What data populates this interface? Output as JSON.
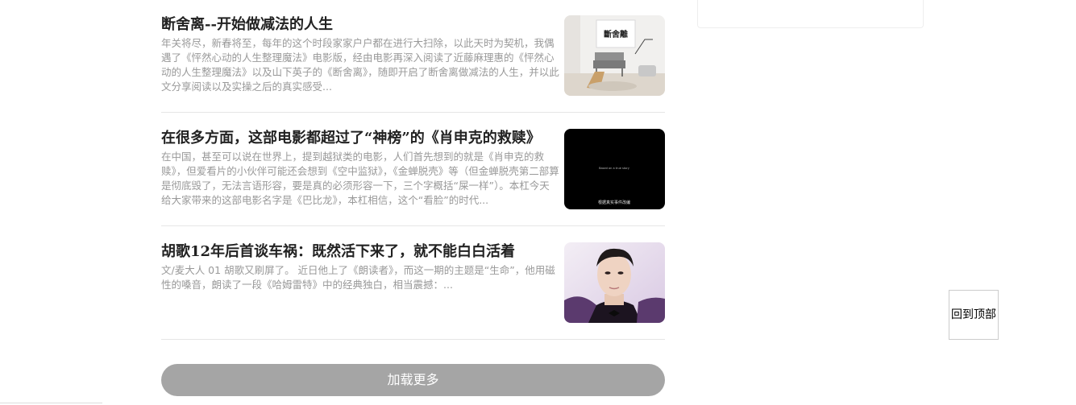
{
  "articles": [
    {
      "title": "断舍离--开始做减法的人生",
      "summary": "年关将尽，新春将至，每年的这个时段家家户户都在进行大扫除，以此天时为契机，我偶遇了《怦然心动的人生整理魔法》电影版，经由电影再深入阅读了近藤麻理惠的《怦然心动的人生整理魔法》以及山下英子的《断舍离》，随即开启了断舍离做减法的人生，并以此文分享阅读以及实操之后的真实感受...",
      "thumb_sign_text": "斷舍離"
    },
    {
      "title": "在很多方面，这部电影都超过了“神榜”的《肖申克的救赎》",
      "summary": "在中国，甚至可以说在世界上，提到越狱类的电影，人们首先想到的就是《肖申克的救赎》，但爱看片的小伙伴可能还会想到《空中监狱》，《金蝉脱壳》等（但金蝉脱壳第二部算是彻底毁了，无法言语形容，要是真的必须形容一下，三个字概括“屎一样”）。本杠今天给大家带来的这部电影名字是《巴比龙》，本杠相信，这个“看脸”的时代...",
      "thumb_caption_top": "Based on a true story",
      "thumb_caption_bottom": "根据真实事件改编"
    },
    {
      "title": "胡歌12年后首谈车祸：既然活下来了，就不能白白活着",
      "summary": "文/麦大人 01 胡歌又刷屏了。 近日他上了《朗读者》，而这一期的主题是“生命”，他用磁性的嗓音，朗读了一段《哈姆雷特》中的经典独白，相当震撼：..."
    }
  ],
  "load_more_label": "加载更多",
  "back_to_top_label": "回到顶部",
  "colors": {
    "title": "#222222",
    "summary": "#999999",
    "load_more_bg": "#a5a5a5",
    "divider": "#e6e6e6"
  }
}
